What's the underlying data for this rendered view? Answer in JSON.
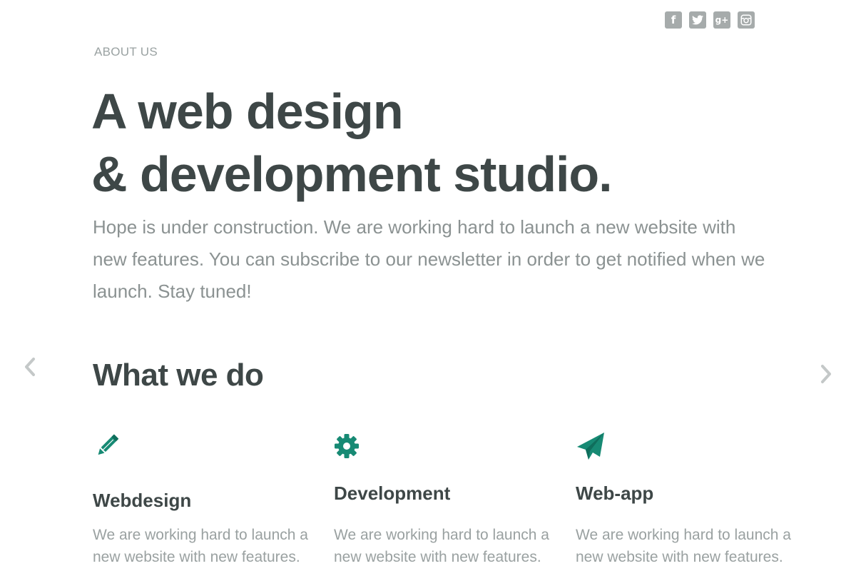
{
  "social": {
    "items": [
      {
        "name": "facebook",
        "glyph": "f",
        "icon": "facebook-icon"
      },
      {
        "name": "twitter",
        "glyph": "",
        "icon": "twitter-icon"
      },
      {
        "name": "google-plus",
        "glyph": "g+",
        "icon": "google-plus-icon"
      },
      {
        "name": "instagram",
        "glyph": "",
        "icon": "instagram-icon"
      }
    ]
  },
  "eyebrow": "ABOUT US",
  "hero": {
    "line1": "A web design",
    "line2": "& development studio."
  },
  "intro": "Hope is under construction. We are working hard to launch a new website with new features. You can subscribe to our newsletter in order to get notified when we launch. Stay tuned!",
  "carousel": {
    "prev_icon": "chevron-left-icon",
    "next_icon": "chevron-right-icon"
  },
  "section_title": "What we do",
  "services": [
    {
      "icon": "pencil-icon",
      "title": "Webdesign",
      "text": "We are working hard to launch a new website with new features."
    },
    {
      "icon": "gear-icon",
      "title": "Development",
      "text": "We are working hard to launch a new website with new features."
    },
    {
      "icon": "paper-plane-icon",
      "title": "Web-app",
      "text": "We are working hard to launch a new website with new features."
    }
  ],
  "colors": {
    "heading": "#3e4747",
    "body_text": "#8b9292",
    "muted": "#9aa2a2",
    "accent": "#178a74",
    "icon_gray": "#a6abab",
    "arrow_gray": "#c4c8c8"
  }
}
